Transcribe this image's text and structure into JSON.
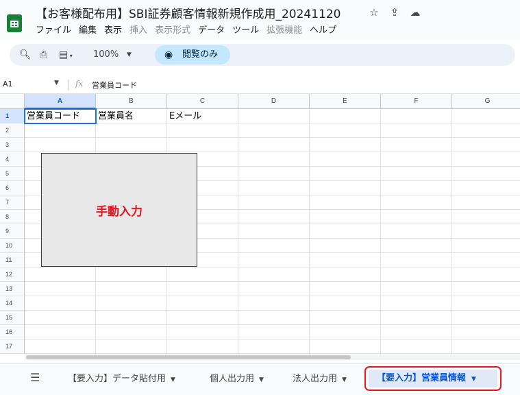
{
  "document": {
    "title": "【お客様配布用】SBI証券顧客情報新規作成用_20241120",
    "icons": [
      "star-icon",
      "move-to-drive-icon",
      "cloud-status-icon"
    ]
  },
  "menu": {
    "file": "ファイル",
    "edit": "編集",
    "view": "表示",
    "insert": "挿入",
    "format": "表示形式",
    "data": "データ",
    "tools": "ツール",
    "extensions": "拡張機能",
    "help": "ヘルプ"
  },
  "toolbar": {
    "zoom": "100%",
    "view_only": "閲覧のみ"
  },
  "formula_bar": {
    "cell_ref": "A1",
    "fx": "fx",
    "value": "営業員コード"
  },
  "grid": {
    "columns": [
      "A",
      "B",
      "C",
      "D",
      "E",
      "F",
      "G"
    ],
    "rows": [
      "1",
      "2",
      "3",
      "4",
      "5",
      "6",
      "7",
      "8",
      "9",
      "10",
      "11",
      "12",
      "13",
      "14",
      "15",
      "16",
      "17"
    ],
    "row1": {
      "a": "営業員コード",
      "b": "営業員名",
      "c": "Eメール"
    },
    "selected_cell": "A1"
  },
  "shape": {
    "label": "手動入力",
    "fill": "#e8e8e8",
    "text_color": "#e8141e"
  },
  "sheets": {
    "tabs": [
      "【要入力】データ貼付用",
      "個人出力用",
      "法人出力用",
      "【要入力】営業員情報"
    ],
    "active": "【要入力】営業員情報",
    "highlight_color": "#e8141e"
  }
}
